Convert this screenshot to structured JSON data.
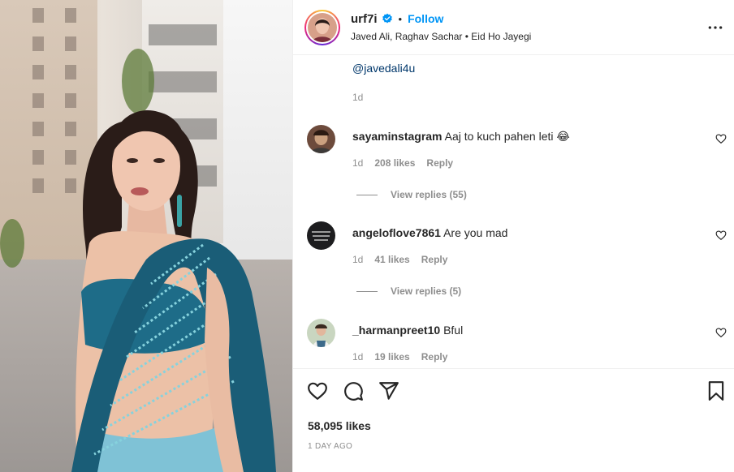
{
  "post": {
    "username": "urf7i",
    "verified": true,
    "separator": "•",
    "follow_label": "Follow",
    "music": "Javed Ali, Raghav Sachar • Eid Ho Jayegi"
  },
  "caption": {
    "mention": "@javedali4u",
    "time": "1d"
  },
  "comments": [
    {
      "username": "sayaminstagram",
      "text": "Aaj to kuch pahen leti 😂",
      "time": "1d",
      "likes": "208 likes",
      "reply_label": "Reply",
      "view_replies": "View replies (55)"
    },
    {
      "username": "angeloflove7861",
      "text": "Are you mad",
      "time": "1d",
      "likes": "41 likes",
      "reply_label": "Reply",
      "view_replies": "View replies (5)"
    },
    {
      "username": "_harmanpreet10",
      "text": "Bful",
      "time": "1d",
      "likes": "19 likes",
      "reply_label": "Reply"
    }
  ],
  "footer": {
    "likes": "58,095 likes",
    "posted": "1 DAY AGO"
  },
  "icons": [
    "verified-badge-icon",
    "more-options-icon",
    "heart-icon",
    "comment-icon",
    "share-icon",
    "bookmark-icon"
  ],
  "colors": {
    "accent": "#0095f6",
    "text": "#262626",
    "muted": "#8e8e8e",
    "mention": "#00376b",
    "saree": "#1f6f86"
  }
}
